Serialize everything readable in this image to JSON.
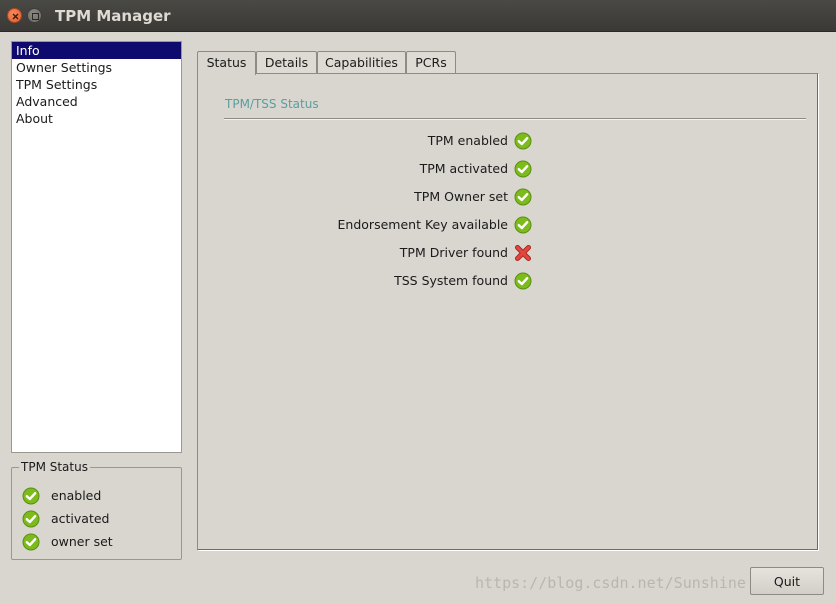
{
  "window": {
    "title": "TPM Manager"
  },
  "sidebar": {
    "items": [
      {
        "label": "Info",
        "selected": true
      },
      {
        "label": "Owner Settings"
      },
      {
        "label": "TPM Settings"
      },
      {
        "label": "Advanced"
      },
      {
        "label": "About"
      }
    ]
  },
  "tpm_status_group": {
    "title": "TPM Status",
    "items": [
      {
        "label": "enabled",
        "icon": "check-icon"
      },
      {
        "label": "activated",
        "icon": "check-icon"
      },
      {
        "label": "owner set",
        "icon": "check-icon"
      }
    ]
  },
  "tabs": [
    {
      "label": "Status",
      "active": true
    },
    {
      "label": "Details"
    },
    {
      "label": "Capabilities"
    },
    {
      "label": "PCRs"
    }
  ],
  "status_panel": {
    "section_title": "TPM/TSS Status",
    "rows": [
      {
        "label": "TPM enabled",
        "icon": "check-icon",
        "ok": true
      },
      {
        "label": "TPM activated",
        "icon": "check-icon",
        "ok": true
      },
      {
        "label": "TPM Owner set",
        "icon": "check-icon",
        "ok": true
      },
      {
        "label": "Endorsement Key available",
        "icon": "check-icon",
        "ok": true
      },
      {
        "label": "TPM Driver found",
        "icon": "cross-icon",
        "ok": false
      },
      {
        "label": "TSS System found",
        "icon": "check-icon",
        "ok": true
      }
    ]
  },
  "buttons": {
    "quit": "Quit"
  },
  "watermark": "https://blog.csdn.net/Sunshine",
  "colors": {
    "selection": "#0e0a6e",
    "section_title": "#5a9ea0",
    "ok_green": "#7dbb1d",
    "error_red": "#d9332a"
  }
}
